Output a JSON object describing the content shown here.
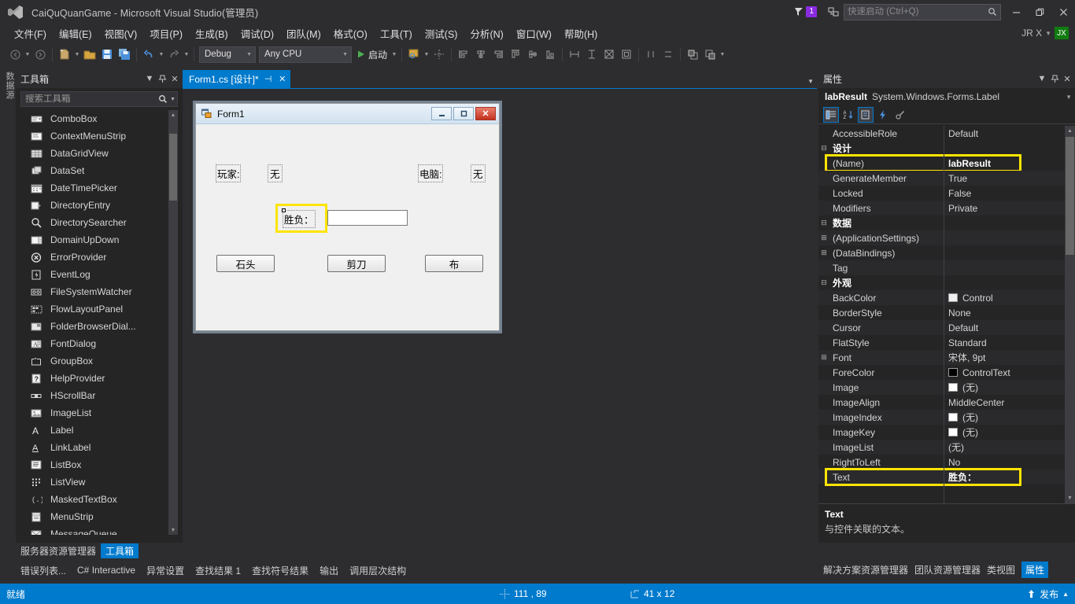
{
  "titlebar": {
    "logo_icon": "visual-studio-logo-icon",
    "title": "CaiQuQuanGame - Microsoft Visual Studio(管理员)",
    "feedback_icon": "feedback-flag-icon",
    "feedback_badge": "1",
    "notify_icon": "notification-icon",
    "quick_launch_placeholder": "快速启动 (Ctrl+Q)",
    "quick_launch_value": "",
    "search_icon": "search-icon",
    "minimize_icon": "minimize-icon",
    "restore_icon": "restore-icon",
    "close_icon": "close-icon"
  },
  "menu": {
    "items": [
      {
        "label": "文件(F)"
      },
      {
        "label": "编辑(E)"
      },
      {
        "label": "视图(V)"
      },
      {
        "label": "项目(P)"
      },
      {
        "label": "生成(B)"
      },
      {
        "label": "调试(D)"
      },
      {
        "label": "团队(M)"
      },
      {
        "label": "格式(O)"
      },
      {
        "label": "工具(T)"
      },
      {
        "label": "测试(S)"
      },
      {
        "label": "分析(N)"
      },
      {
        "label": "窗口(W)"
      },
      {
        "label": "帮助(H)"
      }
    ],
    "account_name": "JR X",
    "account_avatar": "JX"
  },
  "toolbar": {
    "back_icon": "navigate-back-icon",
    "forward_icon": "navigate-forward-icon",
    "new_project_icon": "new-project-icon",
    "open_icon": "open-file-icon",
    "save_icon": "save-icon",
    "save_all_icon": "save-all-icon",
    "undo_icon": "undo-icon",
    "redo_icon": "redo-icon",
    "config_value": "Debug",
    "platform_value": "Any CPU",
    "start_icon": "start-play-icon",
    "start_label": "启动",
    "preview_icon": "preview-changes-icon",
    "align_icons": [
      "align-to-grid-icon",
      "align-lefts-icon",
      "align-centers-icon",
      "align-rights-icon",
      "align-tops-icon",
      "align-middles-icon",
      "align-bottoms-icon",
      "make-same-width-icon",
      "make-same-height-icon",
      "make-same-size-icon",
      "size-to-grid-icon",
      "horiz-spacing-icon",
      "vert-spacing-icon",
      "bring-to-front-icon",
      "send-to-back-icon"
    ]
  },
  "left_vtab": {
    "label": "数据源"
  },
  "toolbox": {
    "title": "工具箱",
    "dropdown_icon": "chevron-down-icon",
    "pin_icon": "pin-icon",
    "close_icon": "close-icon",
    "search_placeholder": "搜索工具箱",
    "search_value": "",
    "search_icon": "search-icon",
    "search_dropdown_icon": "chevron-down-icon",
    "items": [
      {
        "label": "ComboBox",
        "icon": "combobox-icon"
      },
      {
        "label": "ContextMenuStrip",
        "icon": "contextmenustrip-icon"
      },
      {
        "label": "DataGridView",
        "icon": "datagridview-icon"
      },
      {
        "label": "DataSet",
        "icon": "dataset-icon"
      },
      {
        "label": "DateTimePicker",
        "icon": "datetimepicker-icon"
      },
      {
        "label": "DirectoryEntry",
        "icon": "directoryentry-icon"
      },
      {
        "label": "DirectorySearcher",
        "icon": "directorysearcher-icon"
      },
      {
        "label": "DomainUpDown",
        "icon": "domainupdown-icon"
      },
      {
        "label": "ErrorProvider",
        "icon": "errorprovider-icon"
      },
      {
        "label": "EventLog",
        "icon": "eventlog-icon"
      },
      {
        "label": "FileSystemWatcher",
        "icon": "filesystemwatcher-icon"
      },
      {
        "label": "FlowLayoutPanel",
        "icon": "flowlayoutpanel-icon"
      },
      {
        "label": "FolderBrowserDial...",
        "icon": "folderbrowserdialog-icon"
      },
      {
        "label": "FontDialog",
        "icon": "fontdialog-icon"
      },
      {
        "label": "GroupBox",
        "icon": "groupbox-icon"
      },
      {
        "label": "HelpProvider",
        "icon": "helpprovider-icon"
      },
      {
        "label": "HScrollBar",
        "icon": "hscrollbar-icon"
      },
      {
        "label": "ImageList",
        "icon": "imagelist-icon"
      },
      {
        "label": "Label",
        "icon": "label-icon"
      },
      {
        "label": "LinkLabel",
        "icon": "linklabel-icon"
      },
      {
        "label": "ListBox",
        "icon": "listbox-icon"
      },
      {
        "label": "ListView",
        "icon": "listview-icon"
      },
      {
        "label": "MaskedTextBox",
        "icon": "maskedtextbox-icon"
      },
      {
        "label": "MenuStrip",
        "icon": "menustrip-icon"
      },
      {
        "label": "MessageQueue",
        "icon": "messagequeue-icon"
      }
    ]
  },
  "document_tab": {
    "label": "Form1.cs [设计]*",
    "pin_icon": "pin-icon",
    "close_icon": "close-icon",
    "strip_dropdown_icon": "chevron-down-icon"
  },
  "form_designer": {
    "form_icon": "form-icon",
    "form_title": "Form1",
    "minimize_icon": "minimize-icon",
    "maximize_icon": "maximize-icon",
    "close_icon": "close-icon",
    "controls": {
      "player_label": "玩家:",
      "player_value": "无",
      "computer_label": "电脑:",
      "computer_value": "无",
      "result_label": "胜负：",
      "result_textbox_value": "",
      "btn_rock": "石头",
      "btn_scissors": "剪刀",
      "btn_paper": "布"
    }
  },
  "properties": {
    "title": "属性",
    "dropdown_icon": "chevron-down-icon",
    "pin_icon": "pin-icon",
    "close_icon": "close-icon",
    "object_name": "labResult",
    "object_type": "System.Windows.Forms.Label",
    "object_dropdown_icon": "chevron-down-icon",
    "tools": [
      {
        "icon": "categorized-view-icon",
        "active": true
      },
      {
        "icon": "alphabetical-view-icon",
        "active": false
      },
      {
        "icon": "properties-view-icon",
        "active": true
      },
      {
        "icon": "events-view-icon",
        "active": false
      },
      {
        "icon": "property-pages-icon",
        "active": false
      }
    ],
    "rows": [
      {
        "name": "AccessibleRole",
        "value": "Default",
        "kind": "prop"
      },
      {
        "name": "设计",
        "value": "",
        "kind": "category",
        "expander": "minus"
      },
      {
        "name": "(Name)",
        "value": "labResult",
        "kind": "prop",
        "bold": true,
        "highlight": true
      },
      {
        "name": "GenerateMember",
        "value": "True",
        "kind": "prop"
      },
      {
        "name": "Locked",
        "value": "False",
        "kind": "prop"
      },
      {
        "name": "Modifiers",
        "value": "Private",
        "kind": "prop"
      },
      {
        "name": "数据",
        "value": "",
        "kind": "category",
        "expander": "minus"
      },
      {
        "name": "(ApplicationSettings)",
        "value": "",
        "kind": "prop",
        "expander": "plus"
      },
      {
        "name": "(DataBindings)",
        "value": "",
        "kind": "prop",
        "expander": "plus"
      },
      {
        "name": "Tag",
        "value": "",
        "kind": "prop"
      },
      {
        "name": "外观",
        "value": "",
        "kind": "category",
        "expander": "minus"
      },
      {
        "name": "BackColor",
        "value": "Control",
        "kind": "prop",
        "swatch": "#f0f0f0"
      },
      {
        "name": "BorderStyle",
        "value": "None",
        "kind": "prop"
      },
      {
        "name": "Cursor",
        "value": "Default",
        "kind": "prop"
      },
      {
        "name": "FlatStyle",
        "value": "Standard",
        "kind": "prop"
      },
      {
        "name": "Font",
        "value": "宋体, 9pt",
        "kind": "prop",
        "expander": "plus"
      },
      {
        "name": "ForeColor",
        "value": "ControlText",
        "kind": "prop",
        "swatch": "#000000"
      },
      {
        "name": "Image",
        "value": "(无)",
        "kind": "prop",
        "swatch": "#ffffff"
      },
      {
        "name": "ImageAlign",
        "value": "MiddleCenter",
        "kind": "prop"
      },
      {
        "name": "ImageIndex",
        "value": "(无)",
        "kind": "prop",
        "swatch": "#ffffff"
      },
      {
        "name": "ImageKey",
        "value": "(无)",
        "kind": "prop",
        "swatch": "#ffffff"
      },
      {
        "name": "ImageList",
        "value": "(无)",
        "kind": "prop"
      },
      {
        "name": "RightToLeft",
        "value": "No",
        "kind": "prop"
      },
      {
        "name": "Text",
        "value": "胜负：",
        "kind": "prop",
        "bold": true,
        "highlight": true
      }
    ],
    "description_title": "Text",
    "description_text": "与控件关联的文本。",
    "tabs": [
      {
        "label": "解决方案资源管理器",
        "selected": false
      },
      {
        "label": "团队资源管理器",
        "selected": false
      },
      {
        "label": "类视图",
        "selected": false
      },
      {
        "label": "属性",
        "selected": true
      }
    ]
  },
  "bottom_panel_tabs": [
    {
      "label": "服务器资源管理器",
      "selected": false
    },
    {
      "label": "工具箱",
      "selected": true
    }
  ],
  "bottom_tool_tabs": [
    {
      "label": "错误列表..."
    },
    {
      "label": "C# Interactive"
    },
    {
      "label": "异常设置"
    },
    {
      "label": "查找结果 1"
    },
    {
      "label": "查找符号结果"
    },
    {
      "label": "输出"
    },
    {
      "label": "调用层次结构"
    }
  ],
  "status_bar": {
    "ready": "就绪",
    "position_icon": "crosshair-position-icon",
    "position": "111 , 89",
    "size_icon": "size-measure-icon",
    "size": "41 x 12",
    "publish_icon": "publish-up-arrow-icon",
    "publish_label": "发布",
    "publish_caret_icon": "chevron-up-icon"
  },
  "colors": {
    "accent": "#007acc",
    "chrome": "#2d2d30",
    "panel": "#252526",
    "highlight": "#ffe400",
    "green": "#107c10"
  }
}
